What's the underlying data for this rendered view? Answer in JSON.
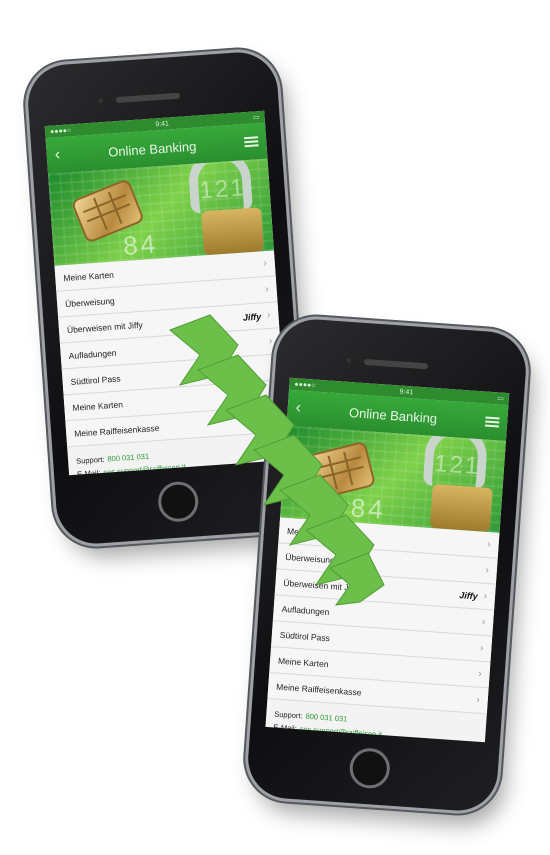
{
  "app": {
    "status_time": "9:41",
    "title": "Online Banking",
    "menu_items": [
      {
        "label": "Meine Karten",
        "badge": ""
      },
      {
        "label": "Überweisung",
        "badge": ""
      },
      {
        "label": "Überweisen mit Jiffy",
        "badge": "Jiffy"
      },
      {
        "label": "Aufladungen",
        "badge": ""
      },
      {
        "label": "Südtirol Pass",
        "badge": ""
      },
      {
        "label": "Meine Karten",
        "badge": ""
      },
      {
        "label": "Meine Raiffeisenkasse",
        "badge": ""
      }
    ],
    "support_label": "Support:",
    "support_phone": "800 031 031",
    "email_label": "E-Mail:",
    "email_value": "sos.support@raiffeisen.it",
    "banner_digits_a": "84",
    "banner_digits_b": "121"
  },
  "colors": {
    "brand_green": "#2e9b36",
    "arrow_green": "#6cc04a"
  },
  "icons": {
    "back": "chevron-left-icon",
    "menu": "hamburger-menu-icon",
    "row": "chevron-right-icon",
    "arrows": "chevron-arrow-icon"
  }
}
